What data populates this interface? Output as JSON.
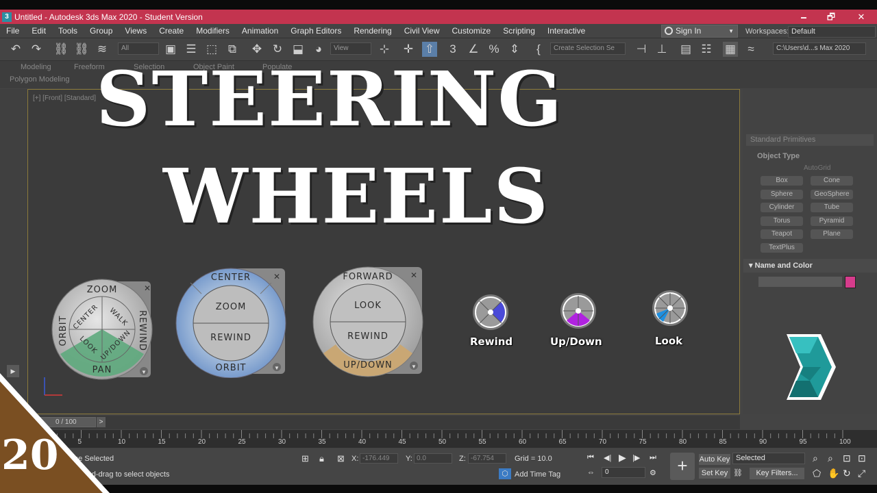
{
  "window": {
    "title": "Untitled - Autodesk 3ds Max 2020 - Student Version",
    "app_icon": "3",
    "minimize": "🗕",
    "maximize": "🗗",
    "close": "✕"
  },
  "menu": [
    "File",
    "Edit",
    "Tools",
    "Group",
    "Views",
    "Create",
    "Modifiers",
    "Animation",
    "Graph Editors",
    "Rendering",
    "Civil View",
    "Customize",
    "Scripting",
    "Interactive"
  ],
  "account": {
    "sign_in": "Sign In",
    "workspaces_label": "Workspaces:",
    "workspace": "Default"
  },
  "toolbar": {
    "filter": "All",
    "view": "View",
    "selection_set": "Create Selection Se",
    "path": "C:\\Users\\d...s Max 2020"
  },
  "ribbon": {
    "tabs": [
      "Modeling",
      "Freeform",
      "Selection",
      "Object Paint",
      "Populate"
    ],
    "sub": "Polygon Modeling"
  },
  "viewport": {
    "label": "[+] [Front] [Standard]"
  },
  "overlay": {
    "line1": "STEERING",
    "line2": "WHEELS",
    "episode": "20"
  },
  "wheels": {
    "full": {
      "top": "ZOOM",
      "left": "ORBIT",
      "right": "REWIND",
      "center": "CENTER",
      "walk": "WALK",
      "look": "LOOK",
      "updown": "UP/DOWN",
      "bottom": "PAN"
    },
    "view_object": {
      "top": "CENTER",
      "middle_top": "ZOOM",
      "middle_bottom": "REWIND",
      "bottom": "ORBIT"
    },
    "tour_building": {
      "top": "FORWARD",
      "middle_top": "LOOK",
      "middle_bottom": "REWIND",
      "bottom": "UP/DOWN"
    },
    "mini": [
      "Rewind",
      "Up/Down",
      "Look"
    ]
  },
  "command_panel": {
    "dropdown": "Standard Primitives",
    "object_type_header": "Object Type",
    "autogrid": "AutoGrid",
    "buttons": [
      "Box",
      "Cone",
      "Sphere",
      "GeoSphere",
      "Cylinder",
      "Tube",
      "Torus",
      "Pyramid",
      "Teapot",
      "Plane",
      "TextPlus"
    ],
    "name_color_header": "Name and Color",
    "swatch_color": "#d63c8c"
  },
  "timeline": {
    "frame": "0 / 100",
    "next": ">",
    "ticks": [
      "5",
      "10",
      "15",
      "20",
      "25",
      "30",
      "35",
      "40",
      "45",
      "50",
      "55",
      "60",
      "65",
      "70",
      "75",
      "80",
      "85",
      "90",
      "95",
      "100"
    ]
  },
  "status": {
    "selected": "None Selected",
    "hint": "Click-and-drag to select objects",
    "x_label": "X:",
    "x": "-176.449",
    "y_label": "Y:",
    "y": "0.0",
    "z_label": "Z:",
    "z": "-67.754",
    "grid": "Grid = 10.0",
    "add_time_tag": "Add Time Tag",
    "auto_key": "Auto Key",
    "set_key": "Set Key",
    "key_mode": "Selected",
    "frame_field": "0",
    "key_filters": "Key Filters..."
  }
}
